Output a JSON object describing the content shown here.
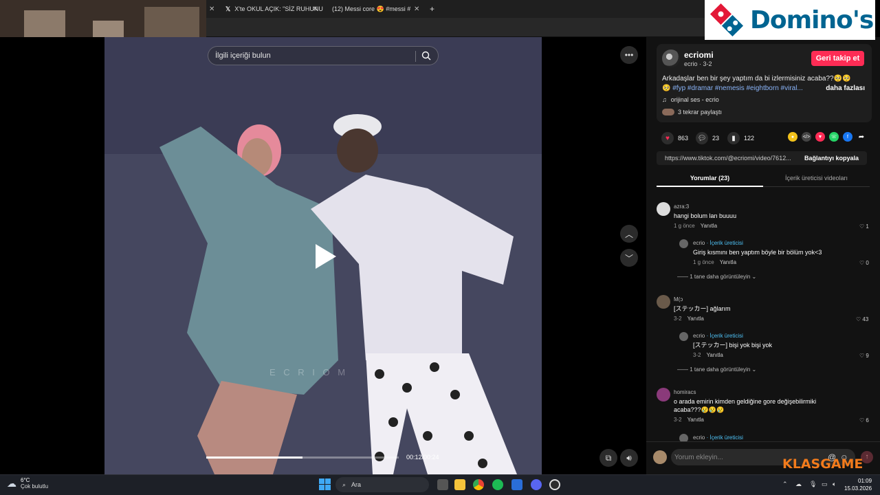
{
  "browser": {
    "tabs": [
      {
        "label": "X'te OKUL AÇIK: \"SİZ RUHUNU",
        "icon": "x-logo-icon"
      },
      {
        "label": "(12) Messi core 😍 #messi #fcb",
        "icon": "youtube-icon"
      }
    ],
    "new_tab": "+"
  },
  "video": {
    "search_placeholder": "İlgili içeriği bulun",
    "time": "00:12/00:24",
    "progress": 0.5,
    "watermark": "E C R I O M"
  },
  "post": {
    "username": "ecriomi",
    "meta": "ecrio · 3-2",
    "follow_label": "Geri takip et",
    "caption_text": "Arkadaşlar ben bir şey yaptım da bi izlermisiniz acaba??🥺🥺",
    "caption_tags": "🥺 #fyp #dramar #nemesis #eightborn #viral...",
    "caption_more": "daha fazlası",
    "sound": "orijinal ses - ecrio",
    "reposts": "3 tekrar paylaştı",
    "likes": "863",
    "comments_count": "23",
    "saves": "122",
    "link": "https://www.tiktok.com/@ecriomi/video/7612...",
    "copy_link": "Bağlantıyı kopyala"
  },
  "tabs": {
    "comments": "Yorumlar (23)",
    "creator_videos": "İçerik üreticisi videoları"
  },
  "comments": [
    {
      "user": "azra:3",
      "text": "hangi bolum lan buuuu",
      "date": "1 g önce",
      "reply": "Yanıtla",
      "likes": "1"
    },
    {
      "user": "ecrio",
      "creator_label": "· İçerik üreticisi",
      "text": "Giriş kısmını ben yaptım böyle bir bölüm yok<3",
      "date": "1 g önce",
      "reply": "Yanıtla",
      "likes": "0"
    },
    {
      "view_more": "1 tane daha görüntüleyin"
    },
    {
      "user": "M(ↄ",
      "text": "[ステッカー] ağlarım",
      "date": "3-2",
      "reply": "Yanıtla",
      "likes": "43"
    },
    {
      "user": "ecrio",
      "creator_label": "· İçerik üreticisi",
      "text": "[ステッカー] bişi yok bişi yok",
      "date": "3-2",
      "reply": "Yanıtla",
      "likes": "9"
    },
    {
      "view_more": "1 tane daha görüntüleyin"
    },
    {
      "user": "homiracs",
      "text": "o arada emirin kimden geldiğine gore değişebilirmiki",
      "text2": "acaba???😢😢😢",
      "date": "3-2",
      "reply": "Yanıtla",
      "likes": "6"
    },
    {
      "user": "ecrio",
      "creator_label": "· İçerik üreticisi"
    }
  ],
  "comment_input_placeholder": "Yorum ekleyin...",
  "overlays": {
    "dominos": "Domino's",
    "klasgame": "KLASGAME"
  },
  "taskbar": {
    "temp": "6°C",
    "weather": "Çok bulutlu",
    "search": "Ara",
    "time": "01:09",
    "date": "15.03.2026"
  },
  "colors": {
    "accent": "#fe2c55",
    "link": "#8ab4f8",
    "creator": "#4fc3f7",
    "dominos_blue": "#006491",
    "klasgame_orange": "#f27b1c"
  }
}
